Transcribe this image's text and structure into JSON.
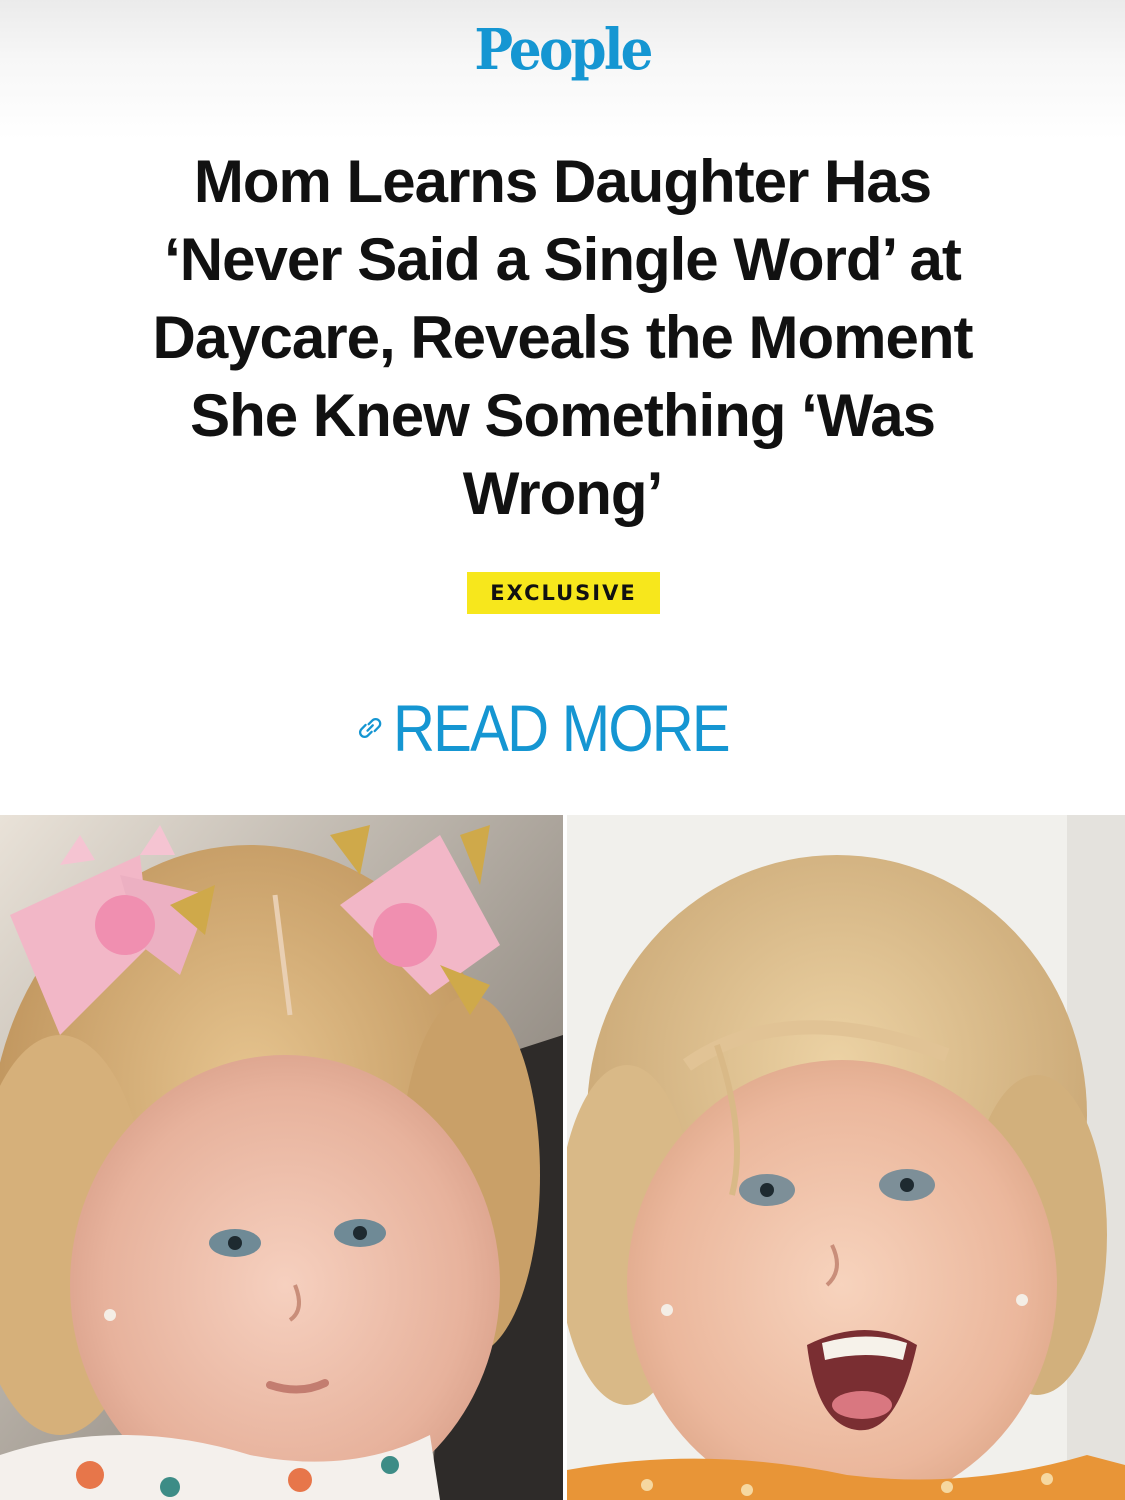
{
  "brand": {
    "logo": "People",
    "color": "#1596d2"
  },
  "article": {
    "headline": "Mom Learns Daughter Has ‘Never Said a Single Word’ at Daycare, Reveals the Moment She Knew Something ‘Was Wrong’",
    "badge": "EXCLUSIVE",
    "badge_color": "#f7e71c"
  },
  "cta": {
    "label": "READ MORE",
    "icon": "link-icon"
  },
  "photos": [
    {
      "name": "photo-left",
      "description_icon": "child-photo"
    },
    {
      "name": "photo-right",
      "description_icon": "child-photo"
    }
  ]
}
